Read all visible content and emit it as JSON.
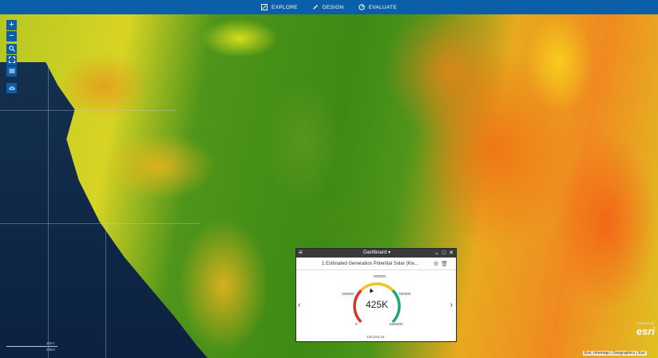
{
  "nav": {
    "items": [
      {
        "label": "EXPLORE",
        "icon": "explore-icon"
      },
      {
        "label": "DESIGN",
        "icon": "design-pencil-icon"
      },
      {
        "label": "EVALUATE",
        "icon": "evaluate-icon"
      }
    ]
  },
  "map_controls": {
    "zoom_in": "+",
    "zoom_out": "−",
    "icons": [
      "zoom-in-icon",
      "zoom-out-icon",
      "search-icon",
      "fullscreen-icon",
      "layers-icon",
      "dashboard-icon"
    ]
  },
  "scale": {
    "top": "20mi",
    "bottom": "20km"
  },
  "attribution": "Esri, Intermap | Geographics | Esri",
  "esri_logo": "esri",
  "powered_by": "POWERED BY",
  "dashboard": {
    "title": "Dashboard ▾",
    "widget_title": "1 Estimated Generation Potential Solar (Kw...",
    "gauge": {
      "value_display": "425K",
      "sub_value": "425,043.44",
      "ticks": [
        "0",
        "250000",
        "500000",
        "750000",
        "1000000"
      ],
      "value": 425043.44,
      "min": 0,
      "max": 1000000
    },
    "colors": {
      "red": "#d7362a",
      "yellow": "#f2c220",
      "green": "#20a86e"
    }
  },
  "colors": {
    "topbar": "#0b5fa8",
    "panel_header": "#3a3a3a"
  }
}
